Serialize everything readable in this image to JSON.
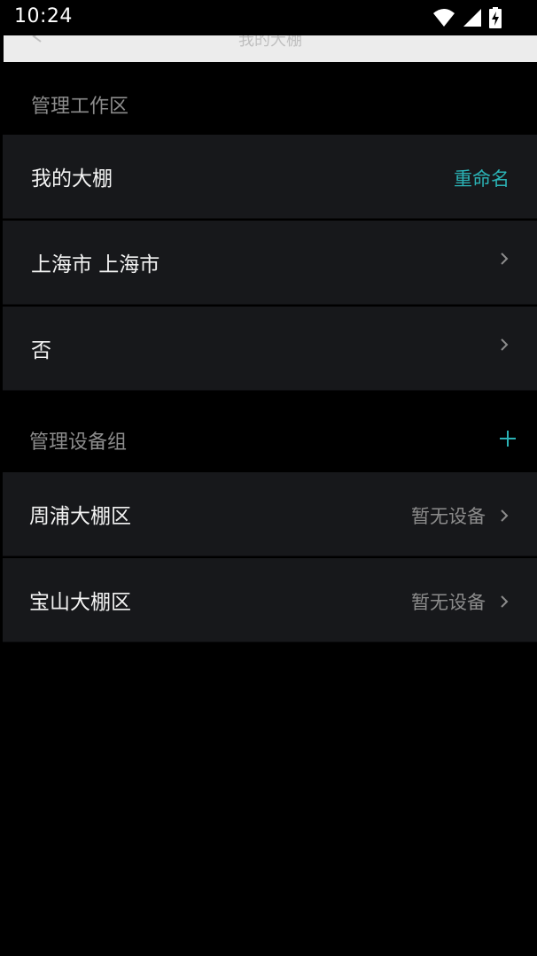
{
  "status_bar": {
    "time": "10:24",
    "icons": [
      "wifi-icon",
      "signal-icon",
      "battery-charging-icon"
    ]
  },
  "app_bar": {
    "title": "我的大棚",
    "back_icon": "back-arrow-icon"
  },
  "workspace_section": {
    "header": "管理工作区",
    "rows": [
      {
        "label": "我的大棚",
        "action": "重命名"
      },
      {
        "label": "上海市 上海市"
      },
      {
        "label": "否"
      }
    ]
  },
  "device_group_section": {
    "header": "管理设备组",
    "add_icon": "plus-icon",
    "rows": [
      {
        "label": "周浦大棚区",
        "status": "暂无设备"
      },
      {
        "label": "宝山大棚区",
        "status": "暂无设备"
      }
    ]
  },
  "colors": {
    "background": "#000000",
    "row_background": "#17181b",
    "accent": "#2bb3b6",
    "secondary_text": "#8c8c8c"
  }
}
